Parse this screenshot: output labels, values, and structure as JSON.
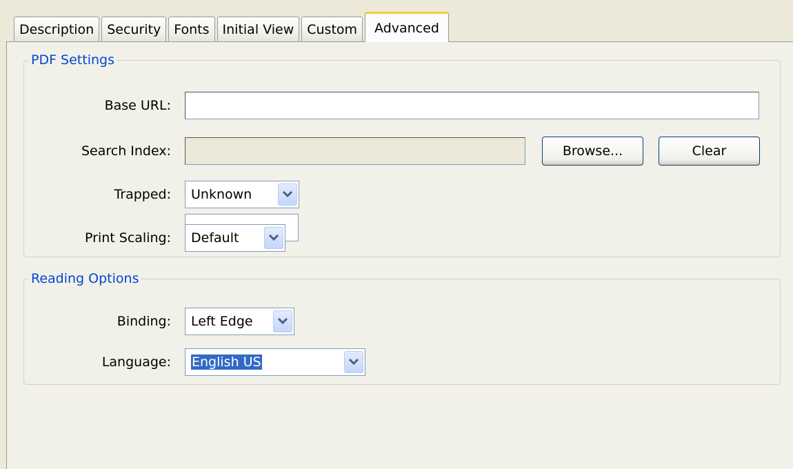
{
  "tabs": [
    {
      "label": "Description"
    },
    {
      "label": "Security"
    },
    {
      "label": "Fonts"
    },
    {
      "label": "Initial View"
    },
    {
      "label": "Custom"
    },
    {
      "label": "Advanced"
    }
  ],
  "active_tab": "Advanced",
  "pdf_settings": {
    "title": "PDF Settings",
    "base_url": {
      "label": "Base URL:",
      "value": ""
    },
    "search_index": {
      "label": "Search Index:",
      "value": "",
      "browse_label": "Browse...",
      "clear_label": "Clear"
    },
    "trapped": {
      "label": "Trapped:",
      "value": "Unknown"
    },
    "print_scaling": {
      "label": "Print Scaling:",
      "value": "Default"
    }
  },
  "reading_options": {
    "title": "Reading Options",
    "binding": {
      "label": "Binding:",
      "value": "Left Edge"
    },
    "language": {
      "label": "Language:",
      "value": "English US"
    }
  },
  "icons": {
    "dropdown_arrow": "chevron-down-icon"
  },
  "colors": {
    "group_title": "#0046d5",
    "active_tab_accent": "#ffc83c",
    "selection": "#316ac5"
  }
}
